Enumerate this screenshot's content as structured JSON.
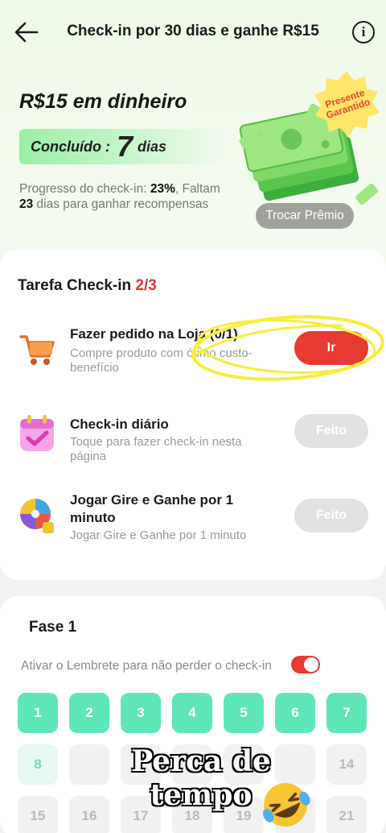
{
  "header": {
    "title": "Check-in por 30 dias e ganhe R$15",
    "info_glyph": "i"
  },
  "summary": {
    "prize_title": "R$15 em dinheiro",
    "done_label": "Concluído :",
    "done_days": "7",
    "done_unit": "dias",
    "progress_prefix": "Progresso do check-in: ",
    "progress_percent": "23%",
    "remaining_prefix": ", Faltam ",
    "remaining_days": "23",
    "remaining_suffix": " dias para ganhar recompensas",
    "badge_text": "Presente Garantido",
    "exchange_button": "Trocar Prêmio"
  },
  "tasks": {
    "title": "Tarefa Check-in",
    "count": "2/3",
    "items": [
      {
        "name": "Fazer pedido na Loja  (0/1)",
        "desc": "Compre produto com ótimo custo-benefício",
        "button": "Ir",
        "icon": "cart-icon"
      },
      {
        "name": "Check-in diário",
        "desc": "Toque para fazer check-in nesta página",
        "button": "Feito",
        "icon": "calendar-icon"
      },
      {
        "name": "Jogar Gire e Ganhe por 1 minuto",
        "desc": "Jogar Gire e Ganhe por 1 minuto",
        "button": "Feito",
        "icon": "wheel-icon"
      }
    ]
  },
  "phase": {
    "title": "Fase 1",
    "reminder": "Ativar o Lembrete para não perder o check-in",
    "reminder_on": true,
    "days": [
      "1",
      "2",
      "3",
      "4",
      "5",
      "6",
      "7",
      "8",
      "",
      "",
      "",
      "",
      "",
      "14",
      "15",
      "16",
      "17",
      "18",
      "19",
      "",
      "21"
    ],
    "completed_days": 7
  },
  "overlay": {
    "caption": "Perca de tempo",
    "emoji": "rolling-laughing-emoji"
  },
  "colors": {
    "accent_red": "#e63a33",
    "mint": "#5fe6b8",
    "green_pill": "#99f0a6"
  }
}
